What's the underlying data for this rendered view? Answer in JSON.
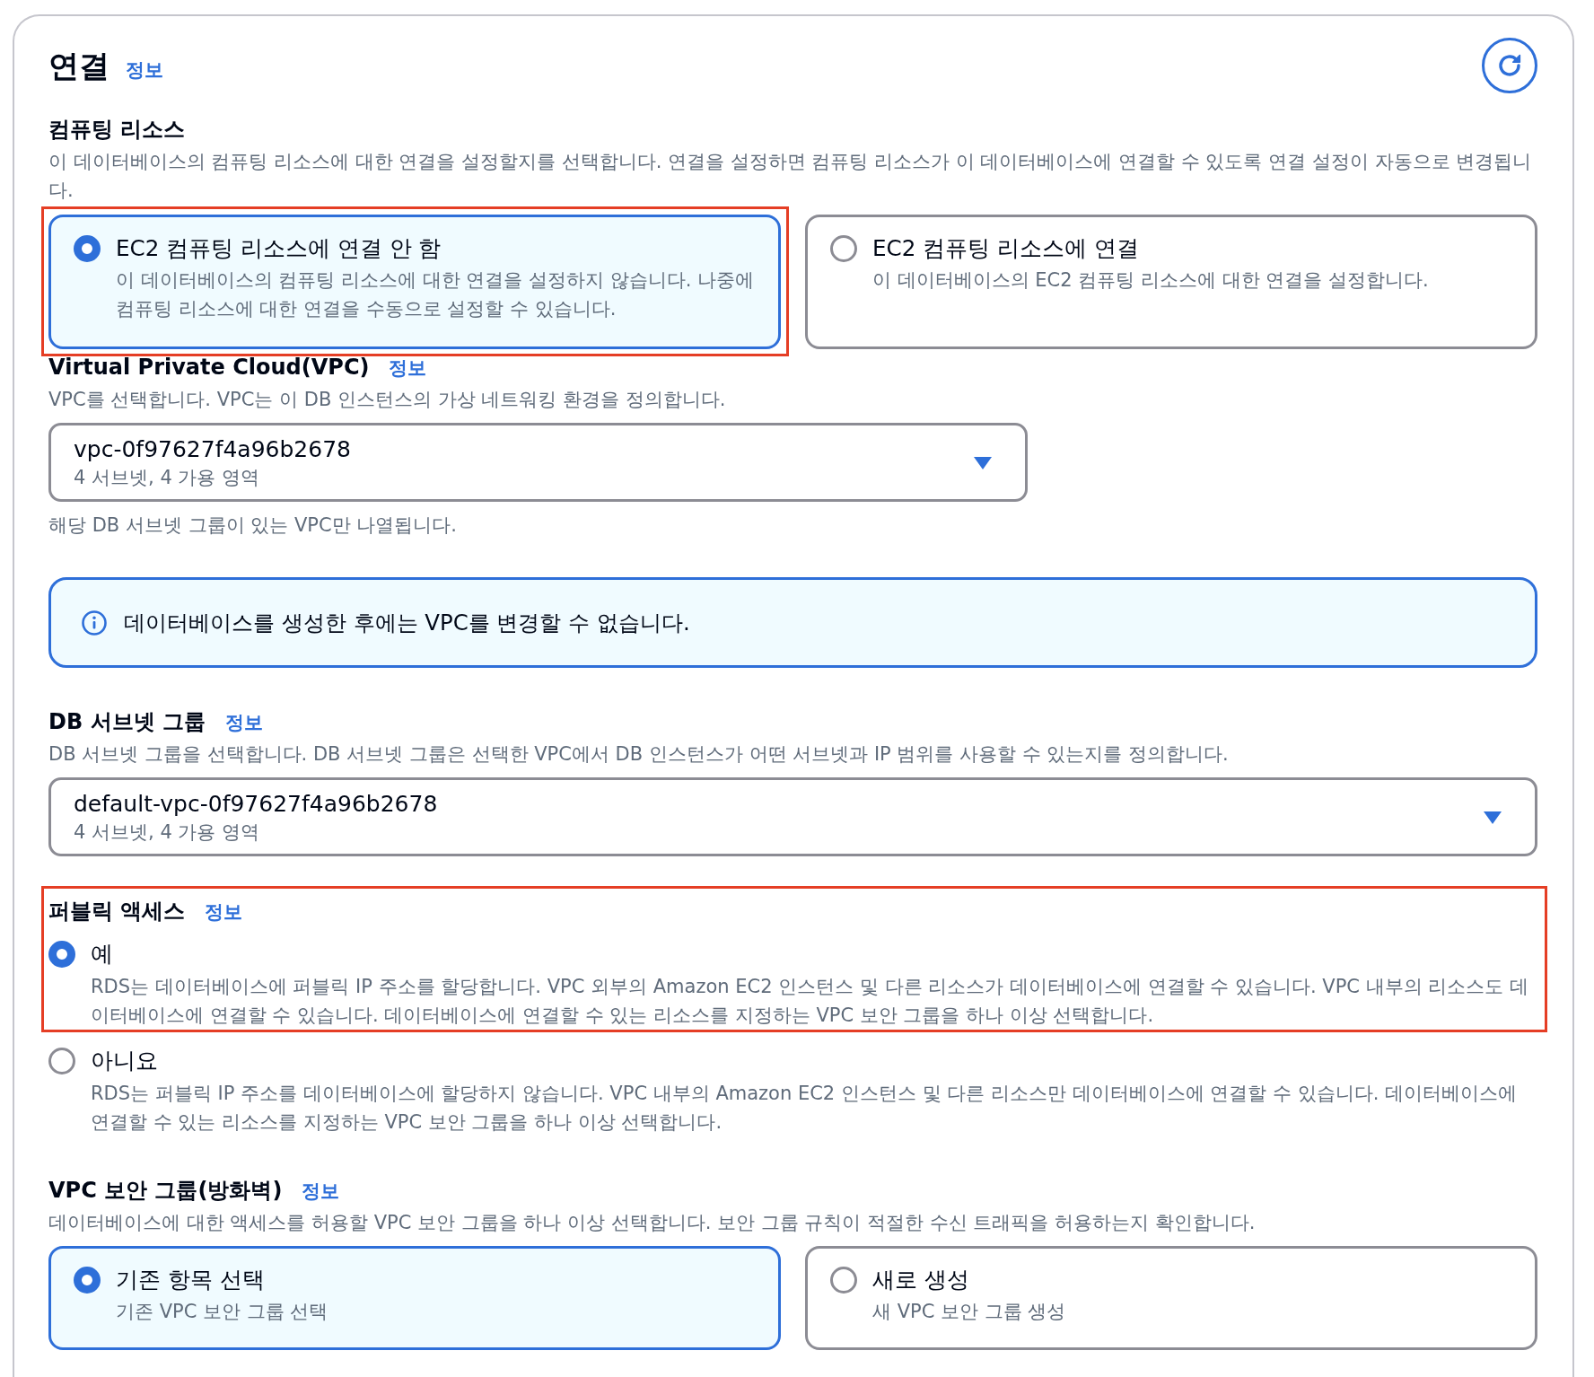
{
  "section": {
    "title": "연결",
    "info_link": "정보"
  },
  "compute_resource": {
    "label": "컴퓨팅 리소스",
    "description": "이 데이터베이스의 컴퓨팅 리소스에 대한 연결을 설정할지를 선택합니다. 연결을 설정하면 컴퓨팅 리소스가 이 데이터베이스에 연결할 수 있도록 연결 설정이 자동으로 변경됩니다.",
    "options": [
      {
        "title": "EC2 컴퓨팅 리소스에 연결 안 함",
        "description": "이 데이터베이스의 컴퓨팅 리소스에 대한 연결을 설정하지 않습니다. 나중에 컴퓨팅 리소스에 대한 연결을 수동으로 설정할 수 있습니다.",
        "selected": true,
        "highlighted": true
      },
      {
        "title": "EC2 컴퓨팅 리소스에 연결",
        "description": "이 데이터베이스의 EC2 컴퓨팅 리소스에 대한 연결을 설정합니다.",
        "selected": false,
        "highlighted": false
      }
    ]
  },
  "vpc": {
    "label": "Virtual Private Cloud(VPC)",
    "info_link": "정보",
    "description": "VPC를 선택합니다. VPC는 이 DB 인스턴스의 가상 네트워킹 환경을 정의합니다.",
    "select": {
      "value": "vpc-0f97627f4a96b2678",
      "detail": "4 서브넷, 4 가용 영역"
    },
    "hint": "해당 DB 서브넷 그룹이 있는 VPC만 나열됩니다.",
    "alert": {
      "kind": "info",
      "text": "데이터베이스를 생성한 후에는 VPC를 변경할 수 없습니다."
    }
  },
  "db_subnet_group": {
    "label": "DB 서브넷 그룹",
    "info_link": "정보",
    "description": "DB 서브넷 그룹을 선택합니다. DB 서브넷 그룹은 선택한 VPC에서 DB 인스턴스가 어떤 서브넷과 IP 범위를 사용할 수 있는지를 정의합니다.",
    "select": {
      "value": "default-vpc-0f97627f4a96b2678",
      "detail": "4 서브넷, 4 가용 영역"
    }
  },
  "public_access": {
    "label": "퍼블릭 액세스",
    "info_link": "정보",
    "options": [
      {
        "title": "예",
        "description": "RDS는 데이터베이스에 퍼블릭 IP 주소를 할당합니다. VPC 외부의 Amazon EC2 인스턴스 및 다른 리소스가 데이터베이스에 연결할 수 있습니다. VPC 내부의 리소스도 데이터베이스에 연결할 수 있습니다. 데이터베이스에 연결할 수 있는 리소스를 지정하는 VPC 보안 그룹을 하나 이상 선택합니다.",
        "selected": true,
        "highlighted": true
      },
      {
        "title": "아니요",
        "description": "RDS는 퍼블릭 IP 주소를 데이터베이스에 할당하지 않습니다. VPC 내부의 Amazon EC2 인스턴스 및 다른 리소스만 데이터베이스에 연결할 수 있습니다. 데이터베이스에 연결할 수 있는 리소스를 지정하는 VPC 보안 그룹을 하나 이상 선택합니다.",
        "selected": false,
        "highlighted": false
      }
    ]
  },
  "vpc_security_group": {
    "label": "VPC 보안 그룹(방화벽)",
    "info_link": "정보",
    "description": "데이터베이스에 대한 액세스를 허용할 VPC 보안 그룹을 하나 이상 선택합니다. 보안 그룹 규칙이 적절한 수신 트래픽을 허용하는지 확인합니다.",
    "options": [
      {
        "title": "기존 항목 선택",
        "description": "기존 VPC 보안 그룹 선택",
        "selected": true
      },
      {
        "title": "새로 생성",
        "description": "새 VPC 보안 그룹 생성",
        "selected": false
      }
    ]
  }
}
